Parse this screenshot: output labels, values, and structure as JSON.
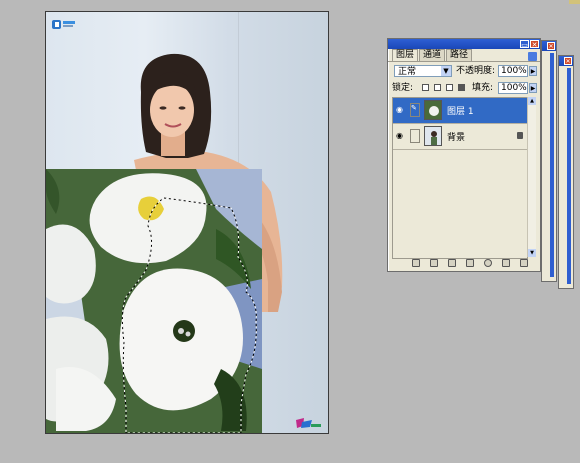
{
  "canvas": {
    "logo_icon": "site-logo-icon",
    "corner_logo_icon": "corner-logo-icon"
  },
  "layers_panel": {
    "tabs": [
      "图层",
      "通道",
      "路径"
    ],
    "active_tab": "图层",
    "blend_mode": "正常",
    "opacity_label": "不透明度:",
    "opacity_value": "100%",
    "lock_label": "锁定:",
    "fill_label": "填充:",
    "fill_value": "100%",
    "layers": [
      {
        "name": "图层 1",
        "selected": true,
        "visible": true
      },
      {
        "name": "背景",
        "selected": false,
        "visible": true,
        "locked": true
      }
    ],
    "bottom_icons": [
      "link-layers-icon",
      "layer-style-icon",
      "mask-icon",
      "new-set-icon",
      "adjustment-layer-icon",
      "new-layer-icon",
      "trash-icon"
    ]
  },
  "colors": {
    "selection_blue": "#316ac5",
    "titlebar_blue": "#1a47b8",
    "panel_bg": "#ece9d8",
    "workspace_gray": "#b9b9b9"
  }
}
